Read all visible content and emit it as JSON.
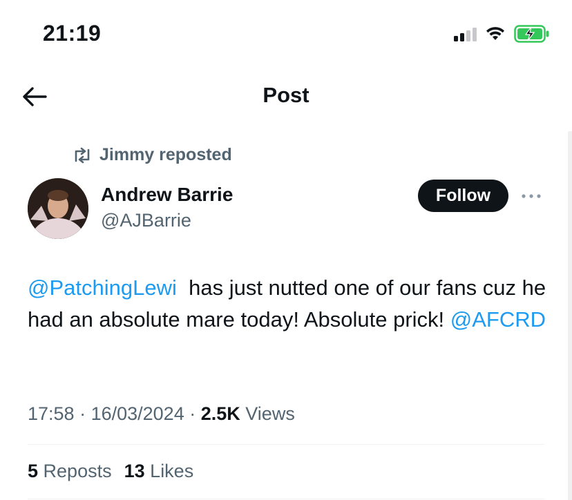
{
  "status_bar": {
    "time": "21:19",
    "battery_color": "#34c759"
  },
  "header": {
    "title": "Post",
    "back_icon": "arrow-left-icon"
  },
  "repost": {
    "icon": "repost-icon",
    "text": "Jimmy reposted"
  },
  "author": {
    "name": "Andrew Barrie",
    "handle": "@AJBarrie",
    "follow_label": "Follow"
  },
  "tweet": {
    "mention1": "@PatchingLewi",
    "text_part1": "  has just nutted one of our fans cuz he had an absolute mare today! Absolute prick! ",
    "mention2": "@AFCRD",
    "time": "17:58",
    "date": "16/03/2024",
    "views_count": "2.5K",
    "views_label": "Views",
    "separator": " · "
  },
  "stats": {
    "reposts_count": "5",
    "reposts_label": "Reposts",
    "likes_count": "13",
    "likes_label": "Likes"
  },
  "colors": {
    "mention": "#1d9bf0",
    "secondary_text": "#536471",
    "primary_text": "#0f1419"
  }
}
